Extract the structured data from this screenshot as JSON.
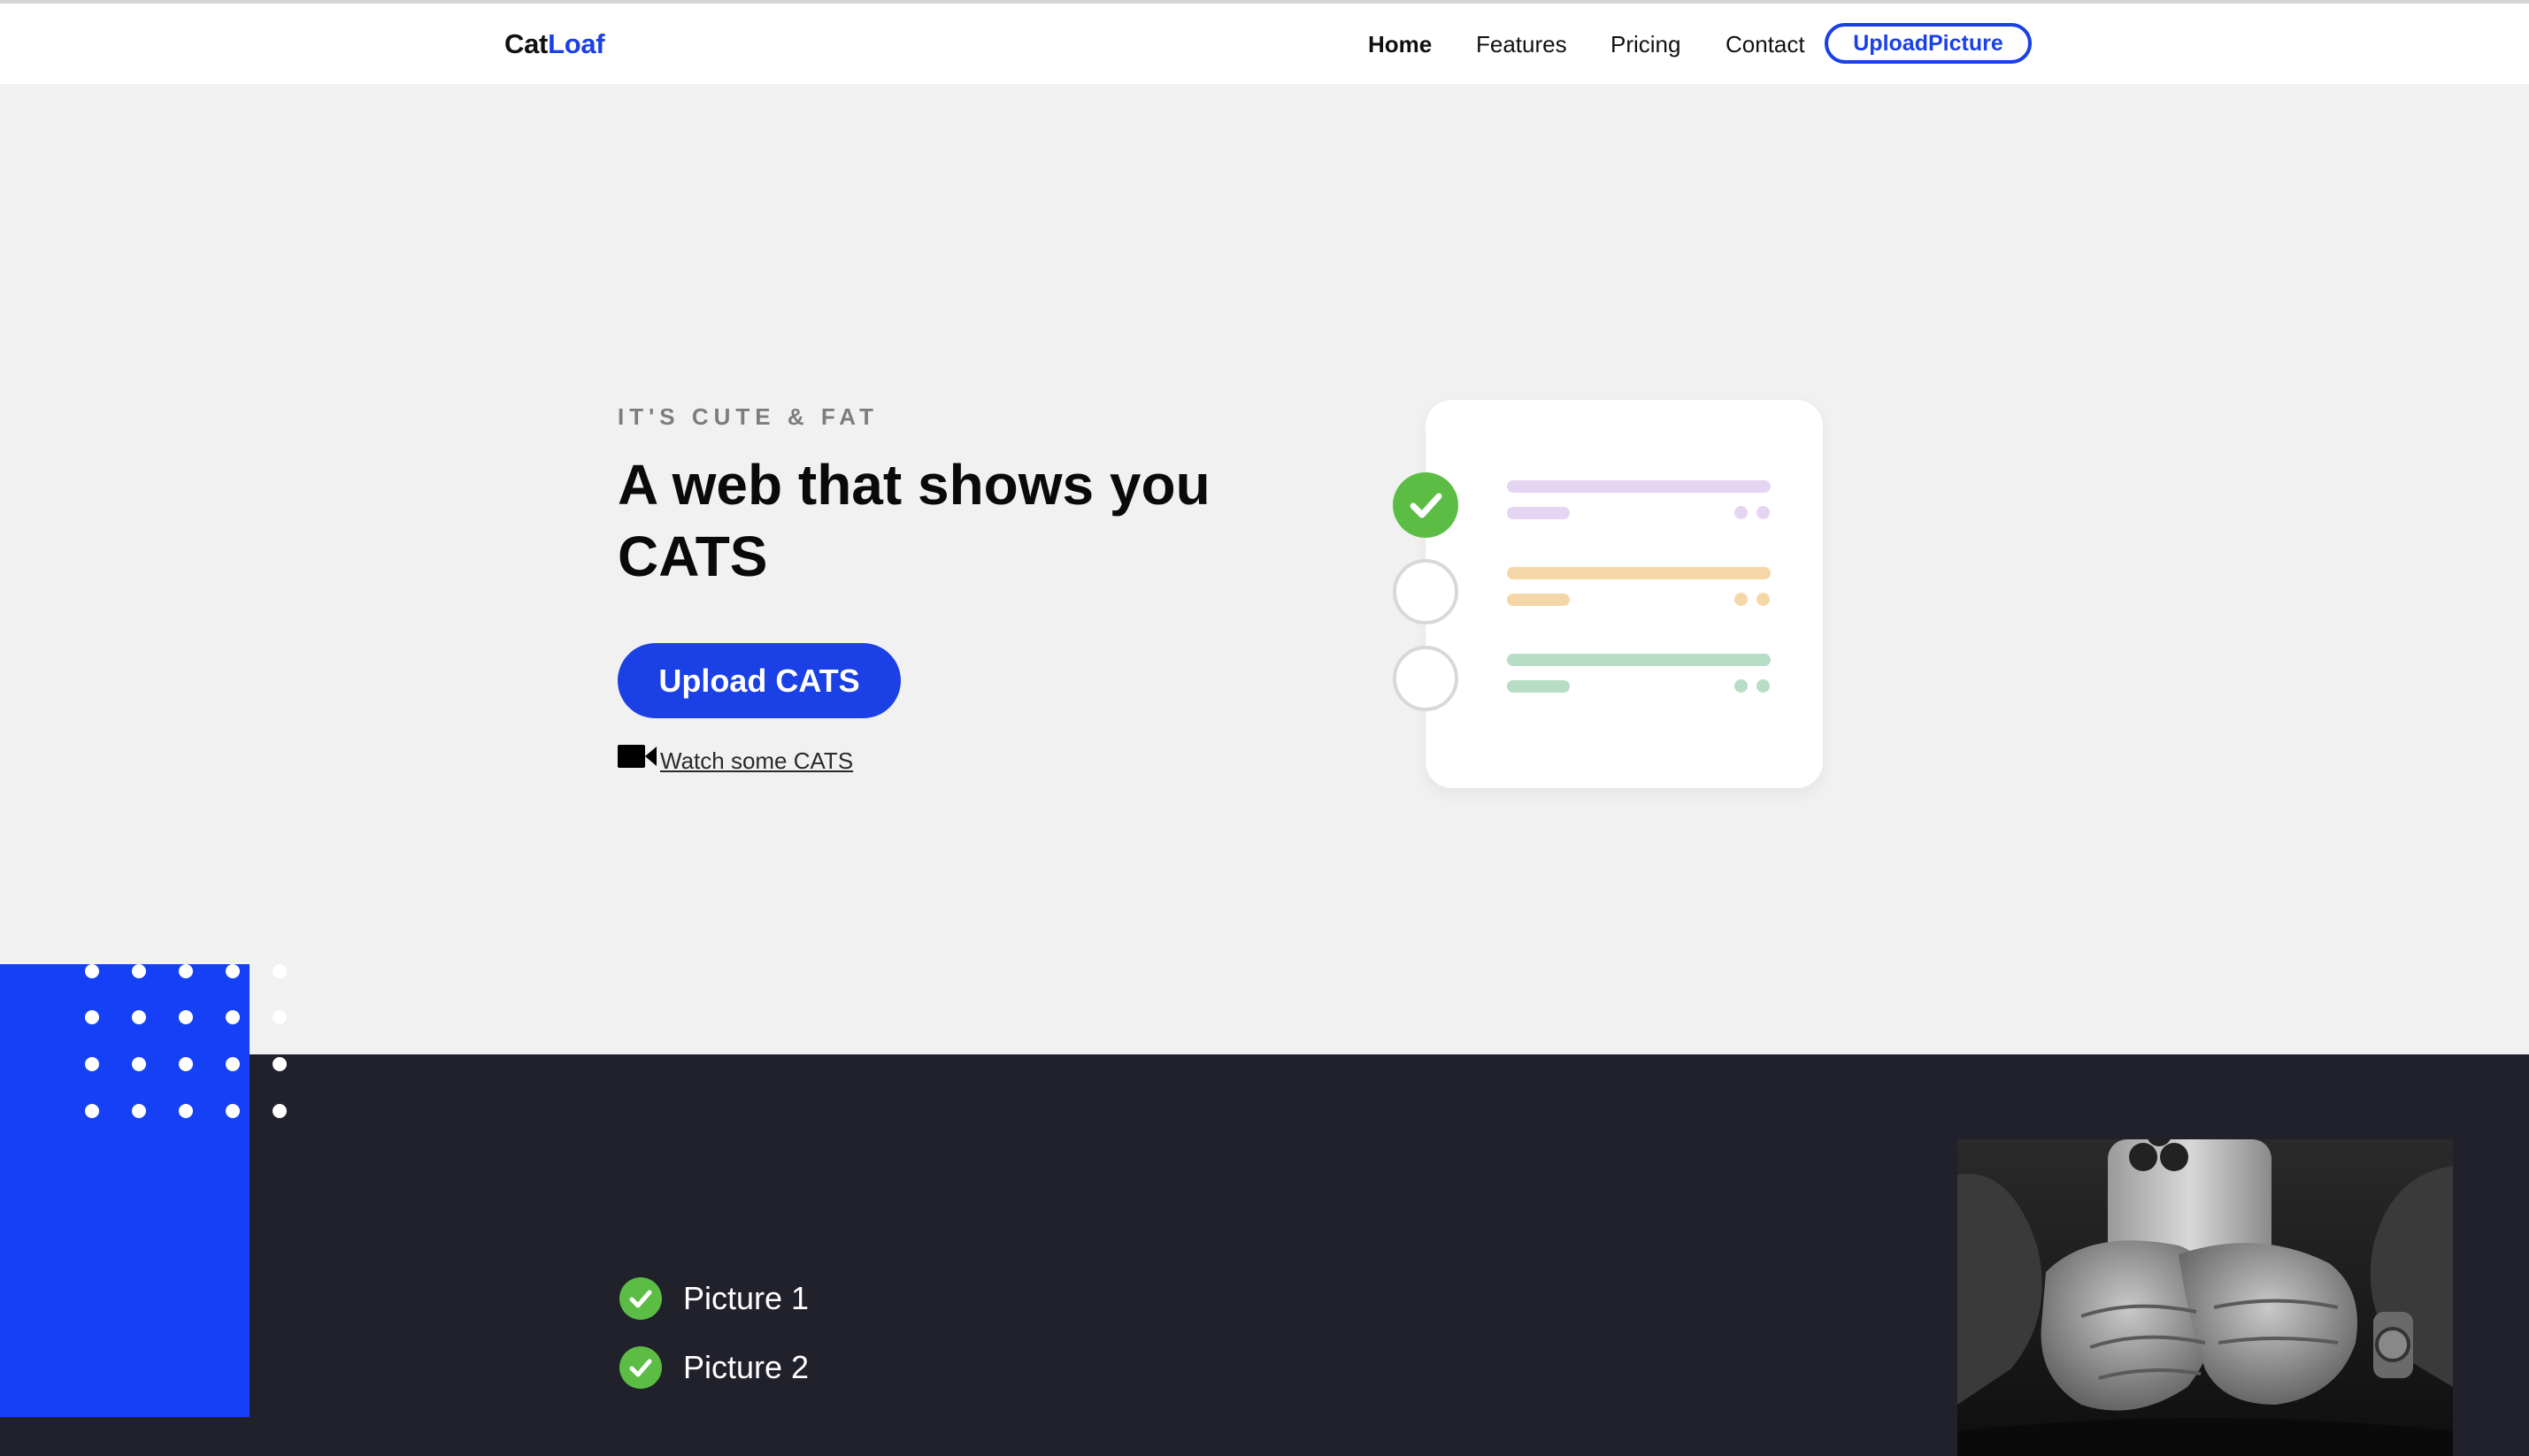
{
  "nav": {
    "brand_part1": "Cat",
    "brand_part2": "Loaf",
    "links": [
      {
        "label": "Home",
        "active": true
      },
      {
        "label": "Features",
        "active": false
      },
      {
        "label": "Pricing",
        "active": false
      },
      {
        "label": "Contact",
        "active": false
      }
    ],
    "cta_label": "UploadPicture"
  },
  "hero": {
    "eyebrow": "IT'S CUTE & FAT",
    "headline": "A web that shows you CATS",
    "primary_button": "Upload CATS",
    "video_link": "Watch some CATS"
  },
  "checklist": {
    "items": [
      {
        "done": true,
        "color": "#e6d4f3",
        "dot_color": "#e6d4f3"
      },
      {
        "done": false,
        "color": "#f5d7a7",
        "dot_color": "#f5d7a7"
      },
      {
        "done": false,
        "color": "#b8ddc7",
        "dot_color": "#b8ddc7"
      }
    ]
  },
  "features": {
    "items": [
      "Picture 1",
      "Picture 2"
    ]
  },
  "colors": {
    "accent": "#1a40e6",
    "blue_block": "#1540f5",
    "dark_section": "#21212c",
    "check_green": "#5bbd44",
    "hero_bg": "#f1f1f1"
  },
  "icons": {
    "video": "video-camera-icon",
    "check": "check-circle-icon"
  }
}
